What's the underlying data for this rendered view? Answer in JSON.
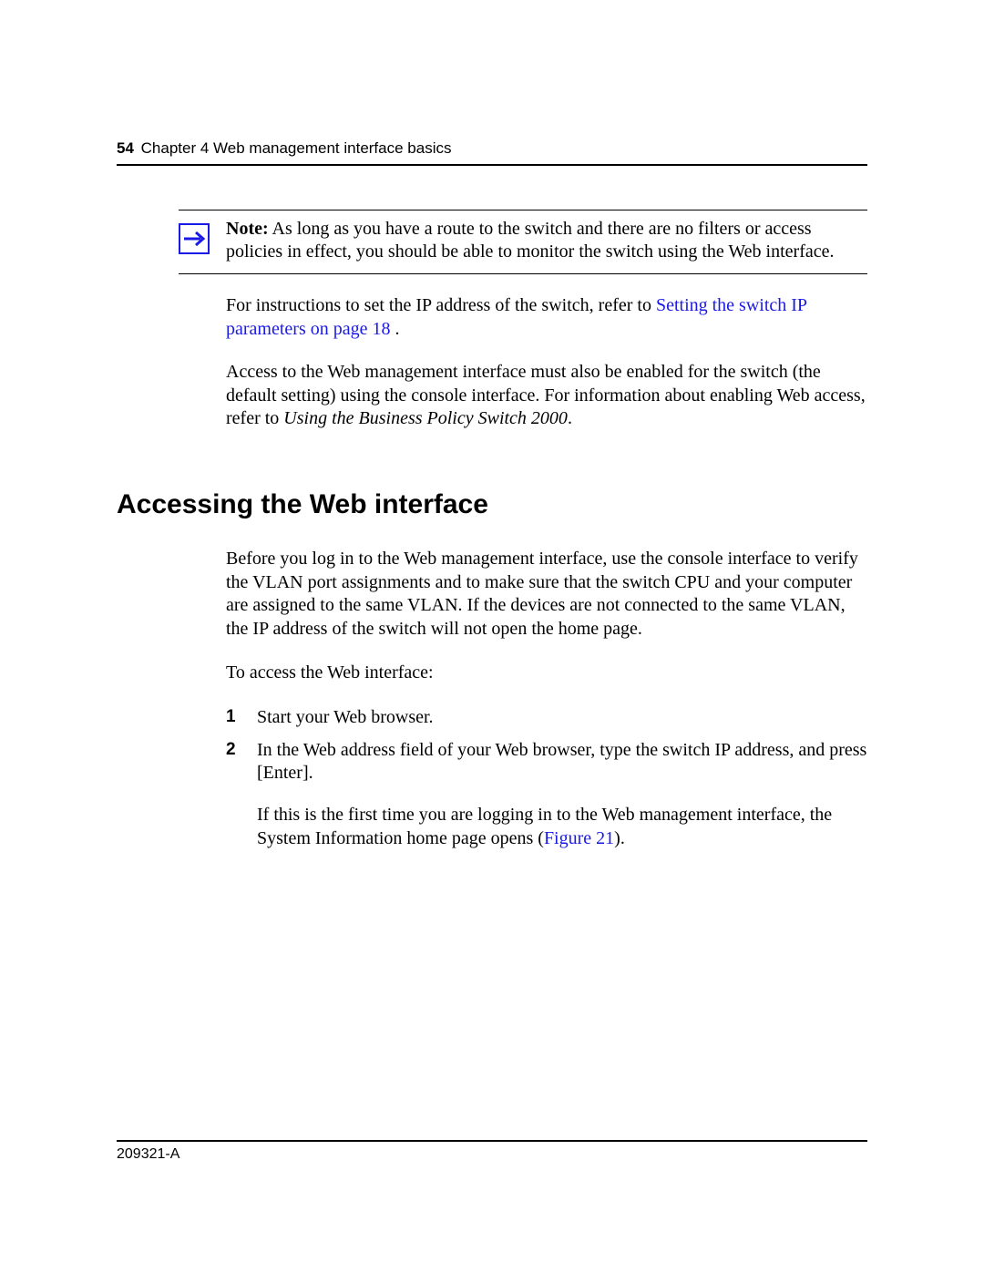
{
  "header": {
    "page_number": "54",
    "chapter_line": "Chapter 4  Web management interface basics"
  },
  "note": {
    "label": "Note:",
    "text": " As long as you have a route to the switch and there are no filters or access policies in effect, you should be able to monitor the switch using the Web interface."
  },
  "para1": {
    "lead": "For instructions to set the IP address of the switch, refer to  ",
    "link": "Setting the switch IP parameters",
    "link_tail": "  on page 18",
    "tail": " ."
  },
  "para2": {
    "lead": "Access to the Web management interface must also be enabled for the switch (the default setting) using the console interface. For information about enabling Web access, refer to ",
    "italic": "Using the Business Policy Switch 2000",
    "tail": "."
  },
  "section_title": "Accessing the Web interface",
  "para3": "Before you log in to the Web management interface, use the console interface to verify the VLAN port assignments and to make sure that the switch CPU and your computer are assigned to the same VLAN. If the devices are not connected to the same VLAN, the IP address of the switch will not open the home page.",
  "para4": "To access the Web interface:",
  "steps": [
    {
      "num": "1",
      "body": "Start your Web browser."
    },
    {
      "num": "2",
      "body": "In the Web address field of your Web browser, type the switch IP address, and press [Enter]."
    }
  ],
  "step_follow": {
    "lead": "If this is the first time you are logging in to the Web management interface, the System Information home page opens (",
    "link": "Figure 21",
    "tail": ")."
  },
  "footer": "209321-A"
}
